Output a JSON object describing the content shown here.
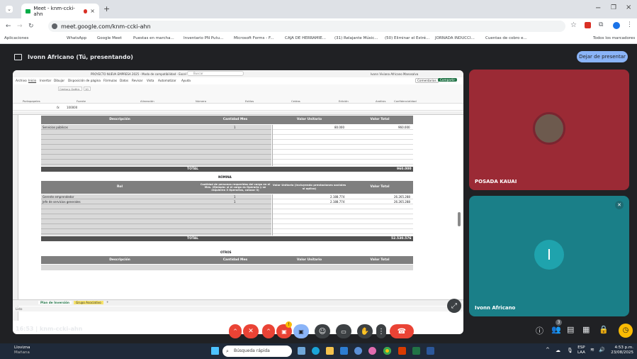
{
  "browser": {
    "tab_title": "Meet - knm-ccki-ahn",
    "url": "meet.google.com/knm-ccki-ahn",
    "bookmarks": [
      "Aplicaciones",
      "WhatsApp",
      "Google Meet",
      "Puestas en marcha...",
      "Inventario PN Putu...",
      "Microsoft Forms - F...",
      "CAJA DE HERRAMIE...",
      "(31) Relajante Músic...",
      "(50) Eliminar el Estré...",
      "JORNADA INDUCCI...",
      "Cuentas de cobro e..."
    ],
    "all_bookmarks": "Todos los marcadores"
  },
  "meet": {
    "presenter_label": "Ivonn Africano (Tú, presentando)",
    "stop_presenting": "Dejar de presentar",
    "meeting_time": "16:53",
    "meeting_code": "knm-ccki-ahn",
    "participants": [
      {
        "name": "POSADA KAUAI",
        "bg": "#9b2a35"
      },
      {
        "name": "Ivonn Africano",
        "initial": "I",
        "bg": "#1a7f88"
      }
    ],
    "participant_count": "3",
    "raised_hand_badge": "!"
  },
  "excel": {
    "title_bar": "PROYECTO NUEVA EMPRESA 2025 - Modo de compatibilidad - Excel",
    "search_placeholder": "Buscar",
    "user": "Ivonn Viviana Africano Manosalva",
    "menu": [
      "Archivo",
      "Inicio",
      "Insertar",
      "Dibujar",
      "Disposición de página",
      "Fórmulas",
      "Datos",
      "Revisar",
      "Vista",
      "Automatizar",
      "Ayuda"
    ],
    "comments": "Comentarios",
    "share": "Compartir",
    "ribbon_groups": [
      "Portapapeles",
      "Fuente",
      "Alineación",
      "Número",
      "Estilos",
      "Celdas",
      "Edición",
      "Análisis",
      "Confidencialidad"
    ],
    "font": "Century Gothic",
    "font_size": "10",
    "cell_value": "100000",
    "sections": {
      "first": {
        "headers": [
          "Descripción",
          "Cantidad Mes",
          "Valor Unitario",
          "Valor Total"
        ],
        "rows": [
          {
            "desc": "Servicios públicos",
            "qty": "1",
            "unit": "80.000",
            "total": "960.000"
          }
        ],
        "total_label": "TOTAL",
        "total_value": "960.000"
      },
      "nomina": {
        "title": "NÓMINA",
        "headers": [
          "Rol",
          "Cantidad de personas requeridas del cargo en el Mes. (Ejemplo: si el cargo es Operario y se requieren 3 Operarios, colocar 3)",
          "Valor Unitario (incluyendo prestaciones sociales si aplica)",
          "Valor Total"
        ],
        "rows": [
          {
            "role": "Gerente emprendedor",
            "qty": "1",
            "unit": "2.188.774",
            "total": "26.265.288"
          },
          {
            "role": "Jefe de servicios generales",
            "qty": "1",
            "unit": "2.188.774",
            "total": "26.265.288"
          }
        ],
        "total_label": "TOTAL",
        "total_value": "52.530.576"
      },
      "otros": {
        "title": "OTROS",
        "headers": [
          "Descripción",
          "Cantidad Mes",
          "Valor Unitario",
          "Valor Total"
        ]
      }
    },
    "sheet_tabs": [
      "Plan de Inversión",
      "Grupo Asociativo"
    ],
    "status": "Listo"
  },
  "taskbar": {
    "weather": "Llovizna",
    "weather_sub": "Mañana",
    "search": "Búsqueda rápida",
    "lang": "ESP",
    "lang_sub": "LAA",
    "time": "4:53 p.m.",
    "date": "23/08/2025"
  }
}
